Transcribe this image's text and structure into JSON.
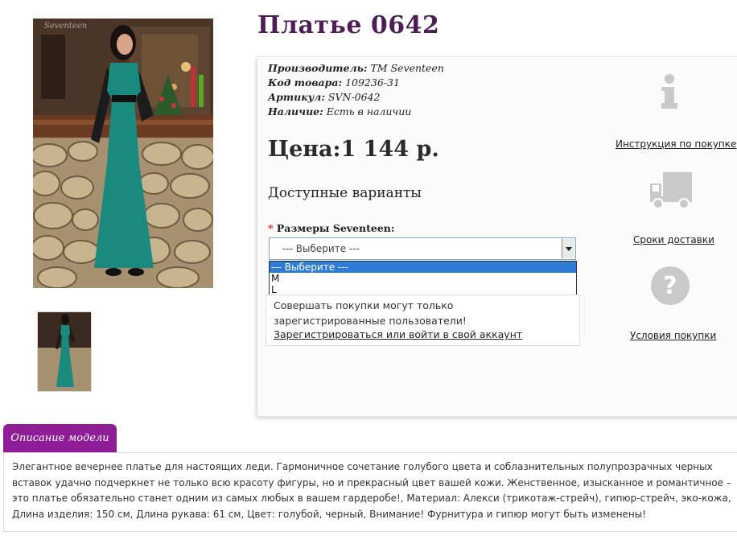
{
  "product": {
    "title": "Платье 0642",
    "photo_brand_text": "Seventeen",
    "specs": [
      {
        "label": "Производитель:",
        "value": "ТМ Seventeen"
      },
      {
        "label": "Код товара:",
        "value": "109236-31"
      },
      {
        "label": "Артикул:",
        "value": "SVN-0642"
      },
      {
        "label": "Наличие:",
        "value": "Есть в наличии"
      }
    ],
    "price": "Цена:1 144 р."
  },
  "options": {
    "heading": "Доступные варианты",
    "size_required_mark": "*",
    "size_label": "Размеры Seventeen:",
    "select_value": "--- Выберите ---",
    "dropdown_options": [
      "--- Выберите ---",
      "M",
      "L"
    ]
  },
  "registration": {
    "message": "Совершать покупки могут только зарегистрированные пользователи!",
    "link": "Зарегистрироваться или войти в свой аккаунт"
  },
  "side_info": [
    {
      "icon": "info-icon",
      "label": "Инструкция по покупке"
    },
    {
      "icon": "truck-icon",
      "label": "Сроки доставки"
    },
    {
      "icon": "question-icon",
      "label": "Условия покупки"
    }
  ],
  "description": {
    "tab_label": "Описание модели",
    "text": "Элегантное вечернее платье для настоящих леди. Гармоничное сочетание голубого цвета и соблазнительных полупрозрачных черных вставок удачно подчеркнет не только всю красоту фигуры, но и прекрасный цвет вашей кожи. Женственное, изысканное и романтичное – это платье обязательно станет одним из самых любых в вашем гардеробе!, Материал: Алекси (трикотаж-стрейч), гипюр-стрейч, эко-кожа, Длина изделия: 150 см, Длина рукава: 61 см, Цвет: голубой, черный, Внимание! Фурнитура и гипюр могут быть изменены!"
  },
  "colors": {
    "title": "#4d1e55",
    "tab": "#8e1d97",
    "dress": "#1a8a7e",
    "select_highlight": "#2f7cd6",
    "required": "#e02020"
  }
}
